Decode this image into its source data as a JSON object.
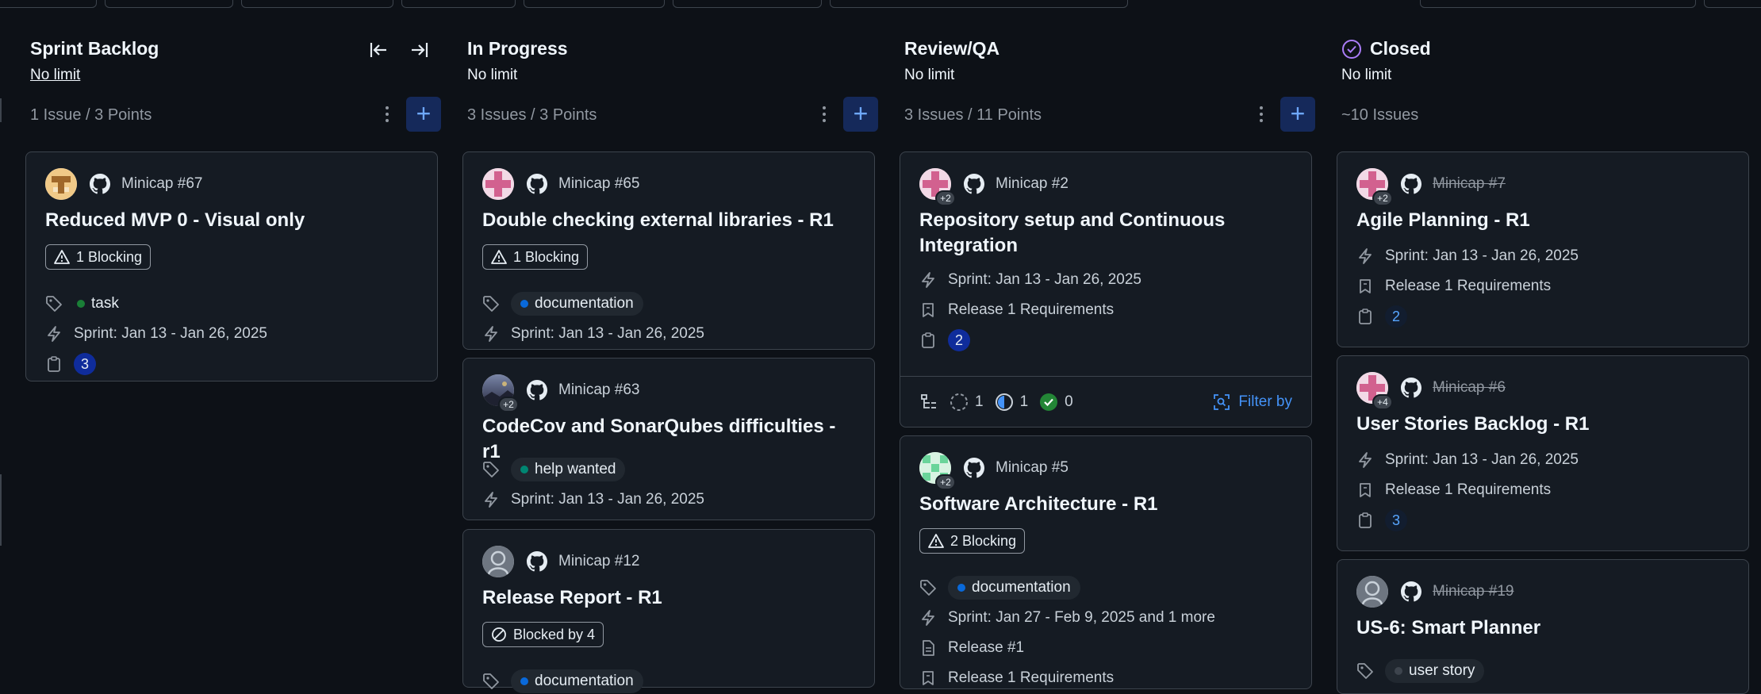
{
  "board": {
    "columns": [
      {
        "title": "Sprint Backlog",
        "limit": "No limit",
        "count": "1 Issue / 3 Points",
        "cards": [
          {
            "ref": "Minicap #67",
            "title": "Reduced MVP 0 - Visual only",
            "blocking": "1 Blocking",
            "label": "task",
            "label_color": "#1a7f37",
            "sprint": "Sprint: Jan 13 - Jan 26, 2025",
            "points": "3"
          }
        ]
      },
      {
        "title": "In Progress",
        "limit": "No limit",
        "count": "3 Issues / 3 Points",
        "cards": [
          {
            "ref": "Minicap #65",
            "title": "Double checking external libraries - R1",
            "blocking": "1 Blocking",
            "label": "documentation",
            "label_color": "#0969da",
            "sprint": "Sprint: Jan 13 - Jan 26, 2025"
          },
          {
            "ref": "Minicap #63",
            "title": "CodeCov and SonarQubes difficulties - r1",
            "avatar_extra": "+2",
            "label": "help wanted",
            "label_color": "#008672",
            "sprint": "Sprint: Jan 13 - Jan 26, 2025"
          },
          {
            "ref": "Minicap #12",
            "title": "Release Report - R1",
            "blocked_by": "Blocked by 4",
            "label": "documentation",
            "label_color": "#0969da"
          }
        ]
      },
      {
        "title": "Review/QA",
        "limit": "No limit",
        "count": "3 Issues / 11 Points",
        "cards": [
          {
            "ref": "Minicap #2",
            "title_line1": "Repository setup and Continuous",
            "title_line2": "Integration",
            "avatar_extra": "+2",
            "sprint": "Sprint: Jan 13 - Jan 26, 2025",
            "milestone": "Release 1 Requirements",
            "points": "2",
            "subissues": {
              "todo": "1",
              "in_progress": "1",
              "done": "0",
              "filter_label": "Filter by"
            }
          },
          {
            "ref": "Minicap #5",
            "title": "Software Architecture - R1",
            "avatar_extra": "+2",
            "blocking": "2 Blocking",
            "label": "documentation",
            "label_color": "#0969da",
            "sprint": "Sprint: Jan 27 - Feb 9, 2025 and 1 more",
            "release": "Release #1",
            "milestone": "Release 1 Requirements"
          }
        ]
      },
      {
        "title": "Closed",
        "limit": "No limit",
        "count": "~10 Issues",
        "cards": [
          {
            "ref": "Minicap #7",
            "title": "Agile Planning - R1",
            "avatar_extra": "+2",
            "sprint": "Sprint: Jan 13 - Jan 26, 2025",
            "milestone": "Release 1 Requirements",
            "points": "2"
          },
          {
            "ref": "Minicap #6",
            "title": "User Stories Backlog - R1",
            "avatar_extra": "+4",
            "sprint": "Sprint: Jan 13 - Jan 26, 2025",
            "milestone": "Release 1 Requirements",
            "points": "3"
          },
          {
            "ref": "Minicap #19",
            "title": "US-6: Smart Planner",
            "label": "user story",
            "label_color": "#3d444d"
          }
        ]
      }
    ]
  },
  "colors": {
    "background": "#0d1117",
    "card": "#151b23",
    "border": "#3d444d",
    "accent": "#4493f8",
    "closed_icon": "#ab7df8"
  }
}
